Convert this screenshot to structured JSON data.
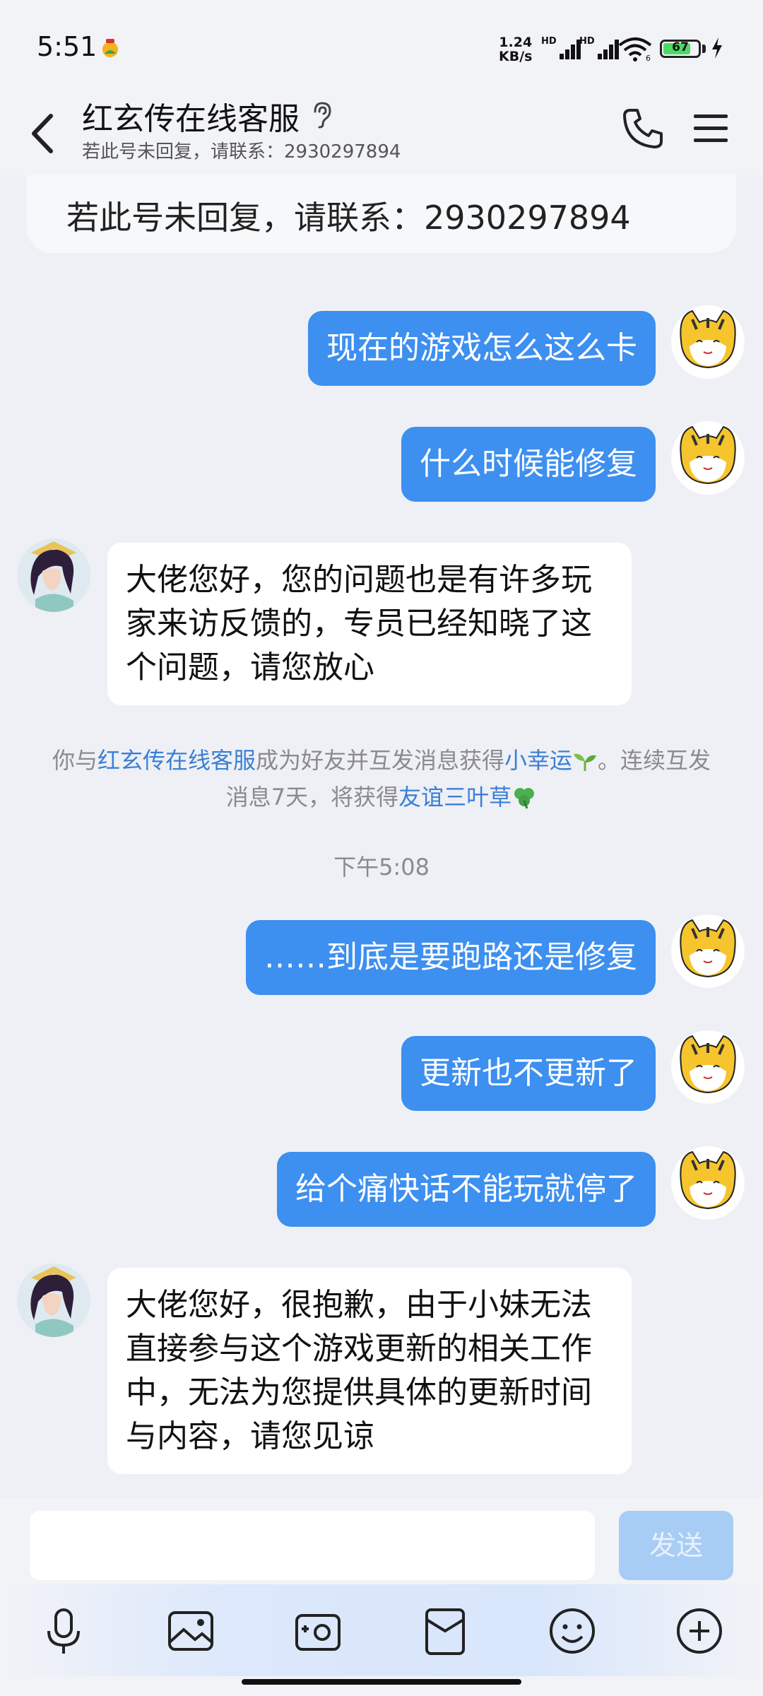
{
  "status_bar": {
    "time": "5:51",
    "net_speed": "1.24",
    "net_unit": "KB/s",
    "sim1": "HD",
    "sim2": "HD",
    "wifi_badge": "6",
    "battery": "67",
    "app_icon": "app-notification-icon"
  },
  "header": {
    "title": "红玄传在线客服",
    "subtitle": "若此号未回复，请联系：2930297894"
  },
  "notice_card": {
    "text": "若此号未回复，请联系：2930297894"
  },
  "messages": [
    {
      "side": "out",
      "text": "现在的游戏怎么这么卡"
    },
    {
      "side": "out",
      "text": "什么时候能修复"
    },
    {
      "side": "in",
      "lines": [
        "大佬您好，您的问题也是有许多玩",
        "家来访反馈的，专员已经知晓了这",
        "个问题，请您放心"
      ]
    },
    {
      "side": "out",
      "text": "……到底是要跑路还是修复"
    },
    {
      "side": "out",
      "text": "更新也不更新了"
    },
    {
      "side": "out",
      "text": "给个痛快话不能玩就停了"
    },
    {
      "side": "in",
      "lines": [
        "大佬您好，很抱歉，由于小妹无法",
        "直接参与这个游戏更新的相关工作",
        "中，无法为您提供具体的更新时间",
        "与内容，请您见谅"
      ]
    }
  ],
  "system_notice": {
    "p1": "你与",
    "link1": "红玄传在线客服",
    "p2": "成为好友并互发消息获得",
    "link2": "小幸运",
    "p3": "。连续互发",
    "p4": "消息7天，将获得",
    "link3": "友谊三叶草"
  },
  "timestamp": "下午5:08",
  "composer": {
    "input_value": "",
    "send_label": "发送"
  },
  "colors": {
    "outgoing_bubble": "#3d8ff0",
    "incoming_bubble": "#ffffff",
    "link": "#3b7fd6",
    "background": "#eef0f5"
  }
}
